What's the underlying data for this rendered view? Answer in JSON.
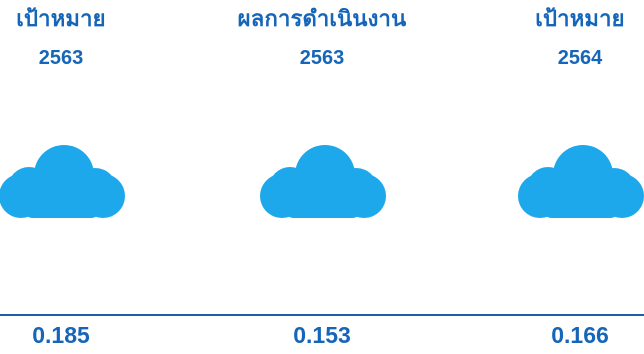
{
  "colors": {
    "text": "#1565b8",
    "cloud": "#1ea8ec",
    "divider": "#1a5ea8",
    "background": "#ffffff"
  },
  "columns": [
    {
      "heading": "เป้าหมาย",
      "year": "2563",
      "icon": "cloud-icon",
      "value": "0.185"
    },
    {
      "heading": "ผลการดำเนินงาน",
      "year": "2563",
      "icon": "cloud-icon",
      "value": "0.153"
    },
    {
      "heading": "เป้าหมาย",
      "year": "2564",
      "icon": "cloud-icon",
      "value": "0.166"
    }
  ]
}
